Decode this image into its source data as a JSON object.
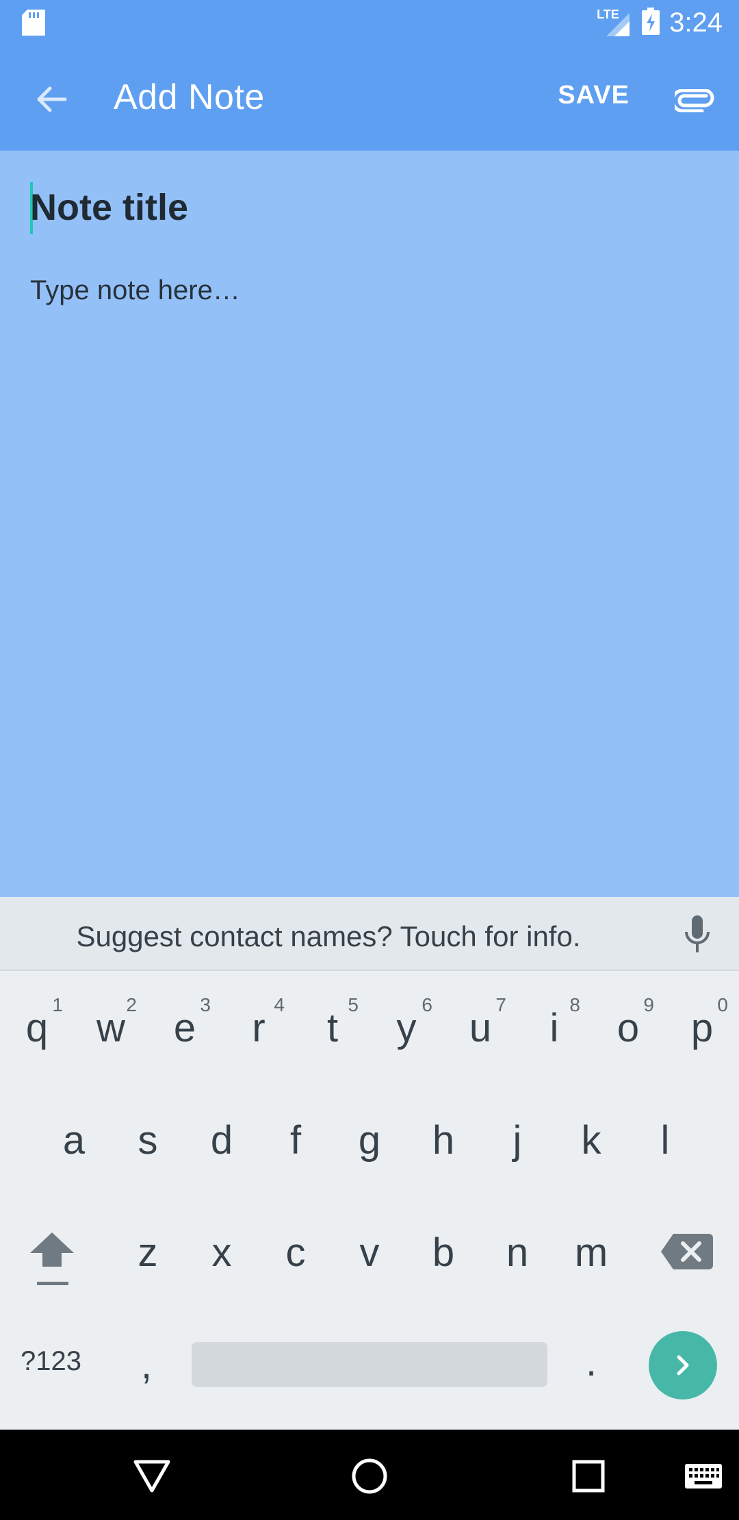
{
  "status": {
    "network": "LTE",
    "time": "3:24"
  },
  "app_bar": {
    "title": "Add Note",
    "save_label": "SAVE"
  },
  "note": {
    "title_placeholder": "Note title",
    "body_placeholder": "Type note here…"
  },
  "keyboard": {
    "suggestion": "Suggest contact names? Touch for info.",
    "row1": [
      {
        "letter": "q",
        "hint": "1"
      },
      {
        "letter": "w",
        "hint": "2"
      },
      {
        "letter": "e",
        "hint": "3"
      },
      {
        "letter": "r",
        "hint": "4"
      },
      {
        "letter": "t",
        "hint": "5"
      },
      {
        "letter": "y",
        "hint": "6"
      },
      {
        "letter": "u",
        "hint": "7"
      },
      {
        "letter": "i",
        "hint": "8"
      },
      {
        "letter": "o",
        "hint": "9"
      },
      {
        "letter": "p",
        "hint": "0"
      }
    ],
    "row2": [
      "a",
      "s",
      "d",
      "f",
      "g",
      "h",
      "j",
      "k",
      "l"
    ],
    "row3": [
      "z",
      "x",
      "c",
      "v",
      "b",
      "n",
      "m"
    ],
    "symbols_label": "?123",
    "comma_label": ",",
    "period_label": "."
  },
  "colors": {
    "app_bar": "#5e9ff1",
    "note_bg": "#94c0f8",
    "accent": "#47b8a7"
  }
}
